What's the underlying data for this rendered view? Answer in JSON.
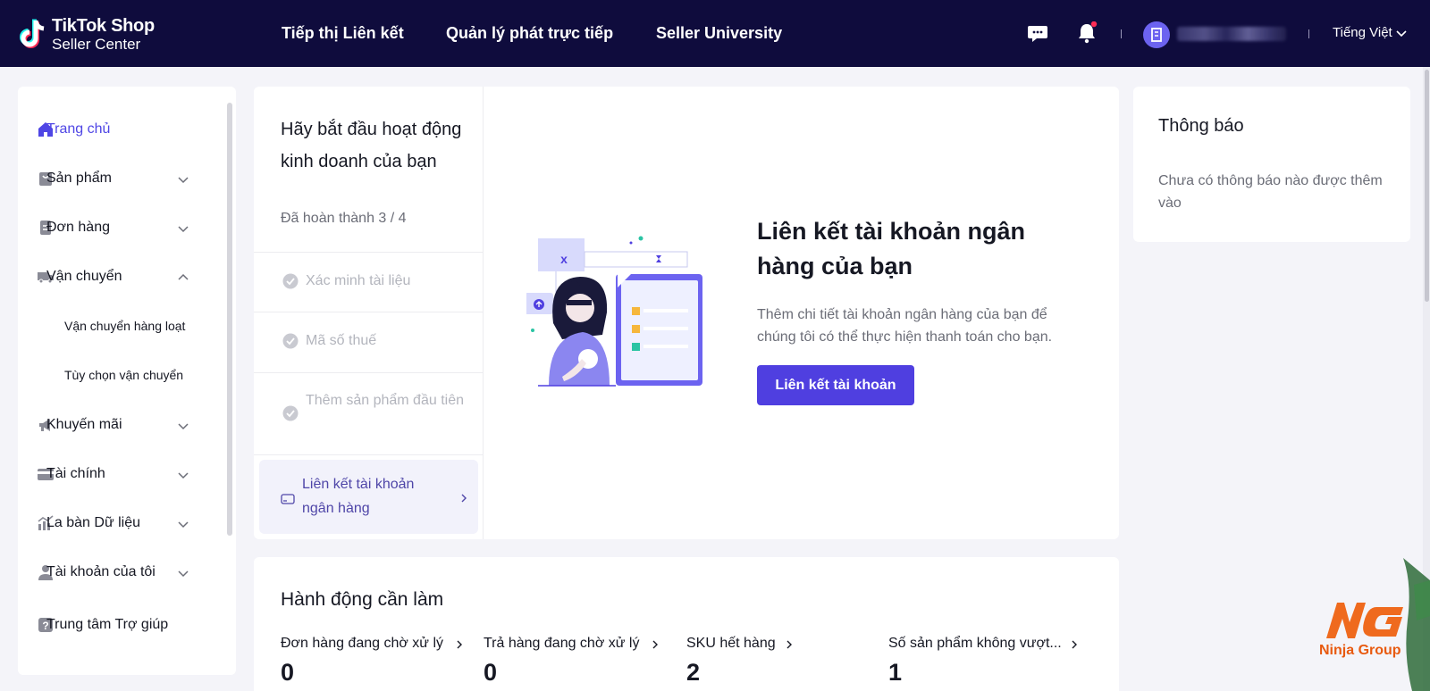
{
  "topbar": {
    "brand_line1": "TikTok Shop",
    "brand_line2": "Seller Center",
    "nav": [
      "Tiếp thị Liên kết",
      "Quản lý phát trực tiếp",
      "Seller University"
    ],
    "language": "Tiếng Việt"
  },
  "sidebar": {
    "items": [
      {
        "label": "Trang chủ",
        "icon": "home-icon",
        "active": true
      },
      {
        "label": "Sản phẩm",
        "icon": "bag-icon",
        "expand": "down"
      },
      {
        "label": "Đơn hàng",
        "icon": "order-icon",
        "expand": "down"
      },
      {
        "label": "Vận chuyển",
        "icon": "truck-icon",
        "expand": "up"
      },
      {
        "label": "Khuyến mãi",
        "icon": "megaphone-icon",
        "expand": "down"
      },
      {
        "label": "Tài chính",
        "icon": "card-icon",
        "expand": "down"
      },
      {
        "label": "La bàn Dữ liệu",
        "icon": "chart-icon",
        "expand": "down"
      },
      {
        "label": "Tài khoản của tôi",
        "icon": "user-icon",
        "expand": "down"
      },
      {
        "label": "Trung tâm Trợ giúp",
        "icon": "help-icon"
      }
    ],
    "subitems": [
      "Vận chuyển hàng loạt",
      "Tùy chọn vận chuyển"
    ]
  },
  "onboarding": {
    "title": "Hãy bắt đầu hoạt động kinh doanh của bạn",
    "progress": "Đã hoàn thành 3 / 4",
    "steps_done": [
      "Xác minh tài liệu",
      "Mã số thuế",
      "Thêm sản phẩm đầu tiên"
    ],
    "step_current": "Liên kết tài khoản ngân hàng",
    "bank": {
      "title": "Liên kết tài khoản ngân hàng của bạn",
      "desc": "Thêm chi tiết tài khoản ngân hàng của bạn để chúng tôi có thể thực hiện thanh toán cho bạn.",
      "button": "Liên kết tài khoản"
    }
  },
  "notifications": {
    "title": "Thông báo",
    "empty": "Chưa có thông báo nào được thêm vào"
  },
  "actions": {
    "title": "Hành động cần làm",
    "metrics": [
      {
        "label": "Đơn hàng đang chờ xử lý",
        "value": "0"
      },
      {
        "label": "Trả hàng đang chờ xử lý",
        "value": "0"
      },
      {
        "label": "SKU hết hàng",
        "value": "2"
      },
      {
        "label": "Số sản phẩm không vượt...",
        "value": "1"
      }
    ]
  },
  "watermark": {
    "text": "Ninja Group"
  },
  "colors": {
    "topbar": "#0f0c3d",
    "accent": "#4f3fe0",
    "active_nav": "#4f46e5"
  }
}
